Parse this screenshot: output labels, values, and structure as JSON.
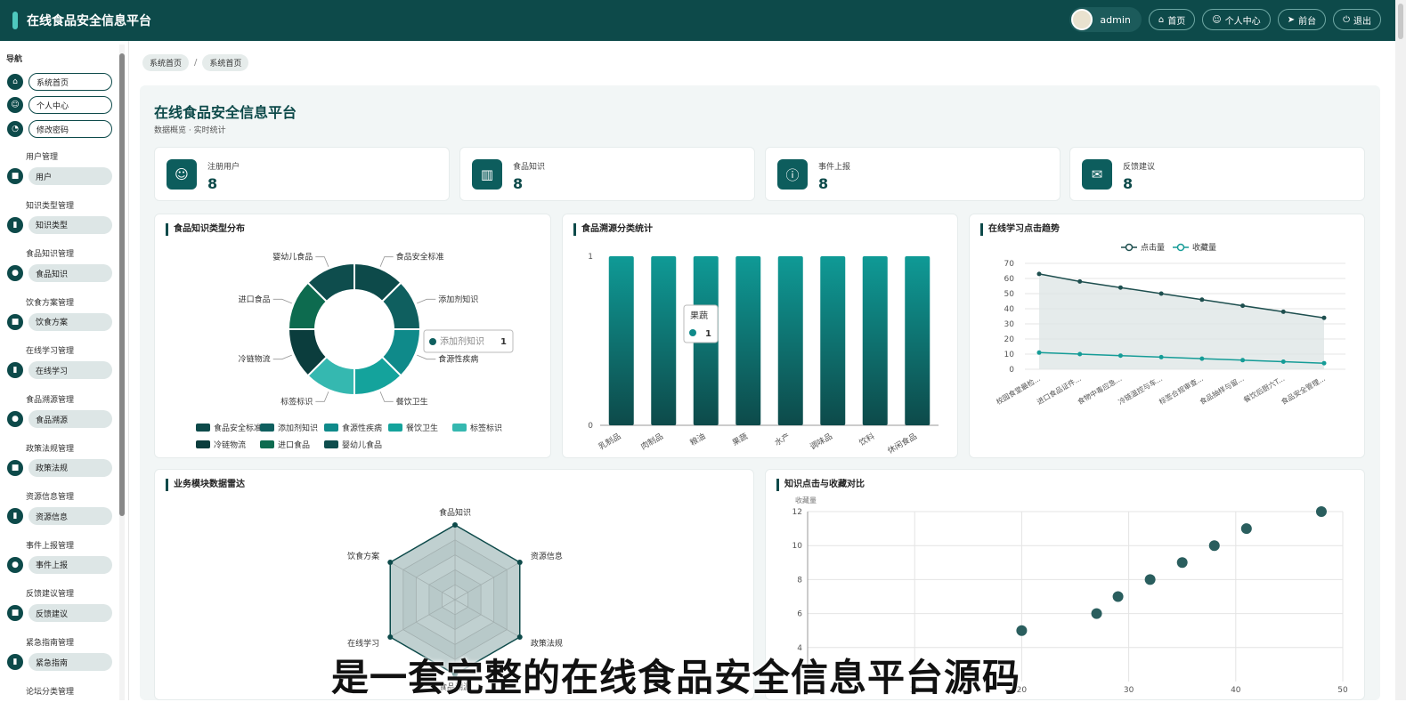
{
  "app": {
    "title": "在线食品安全信息平台"
  },
  "header": {
    "username": "admin",
    "buttons": [
      {
        "label": "首页",
        "icon": "home-icon"
      },
      {
        "label": "个人中心",
        "icon": "user-icon"
      },
      {
        "label": "前台",
        "icon": "send-icon"
      },
      {
        "label": "退出",
        "icon": "power-icon"
      }
    ]
  },
  "sidebar": {
    "title": "导航",
    "top_items": [
      {
        "label": "系统首页",
        "icon": "home-icon"
      },
      {
        "label": "个人中心",
        "icon": "user-icon"
      },
      {
        "label": "修改密码",
        "icon": "lock-icon"
      }
    ],
    "groups": [
      {
        "group": "用户管理",
        "item": "用户",
        "icon": "briefcase-icon"
      },
      {
        "group": "知识类型管理",
        "item": "知识类型",
        "icon": "bar-chart-icon"
      },
      {
        "group": "食品知识管理",
        "item": "食品知识",
        "icon": "location-icon"
      },
      {
        "group": "饮食方案管理",
        "item": "饮食方案",
        "icon": "briefcase-icon"
      },
      {
        "group": "在线学习管理",
        "item": "在线学习",
        "icon": "bar-chart-icon"
      },
      {
        "group": "食品溯源管理",
        "item": "食品溯源",
        "icon": "location-icon"
      },
      {
        "group": "政策法规管理",
        "item": "政策法规",
        "icon": "briefcase-icon"
      },
      {
        "group": "资源信息管理",
        "item": "资源信息",
        "icon": "bar-chart-icon"
      },
      {
        "group": "事件上报管理",
        "item": "事件上报",
        "icon": "location-icon"
      },
      {
        "group": "反馈建议管理",
        "item": "反馈建议",
        "icon": "briefcase-icon"
      },
      {
        "group": "紧急指南管理",
        "item": "紧急指南",
        "icon": "bar-chart-icon"
      },
      {
        "group": "论坛分类管理",
        "item": "",
        "icon": ""
      }
    ]
  },
  "breadcrumb": [
    "系统首页",
    "系统首页"
  ],
  "page": {
    "title": "在线食品安全信息平台",
    "subtitle": "数据概览 · 实时统计"
  },
  "stats": [
    {
      "label": "注册用户",
      "value": "8",
      "icon": "user-icon"
    },
    {
      "label": "食品知识",
      "value": "8",
      "icon": "book-icon"
    },
    {
      "label": "事件上报",
      "value": "8",
      "icon": "alert-icon"
    },
    {
      "label": "反馈建议",
      "value": "8",
      "icon": "chat-icon"
    }
  ],
  "cards": {
    "donut": "食品知识类型分布",
    "bar": "食品溯源分类统计",
    "line": "在线学习点击趋势",
    "radar": "业务模块数据雷达",
    "scatter": "知识点击与收藏对比"
  },
  "colors": {
    "primary": "#0d4a4a",
    "teal": "#0f8a8a",
    "light_teal": "#35b8b0",
    "green": "#0d6b4f"
  },
  "chart_data": [
    {
      "type": "pie",
      "title": "食品知识类型分布",
      "labels": [
        "食品安全标准",
        "添加剂知识",
        "食源性疾病",
        "餐饮卫生",
        "标签标识",
        "冷链物流",
        "进口食品",
        "婴幼儿食品"
      ],
      "values": [
        1,
        1,
        1,
        1,
        1,
        1,
        1,
        1
      ],
      "colors": [
        "#0d4a4a",
        "#0f5f5f",
        "#0f8a8a",
        "#14a39c",
        "#35b8b0",
        "#0b3d3d",
        "#0d6b4f",
        "#0e4d4d"
      ],
      "tooltip": {
        "label": "添加剂知识",
        "value": "1"
      },
      "legend": "bottom"
    },
    {
      "type": "bar",
      "title": "食品溯源分类统计",
      "categories": [
        "乳制品",
        "肉制品",
        "粮油",
        "果蔬",
        "水产",
        "调味品",
        "饮料",
        "休闲食品"
      ],
      "values": [
        1,
        1,
        1,
        1,
        1,
        1,
        1,
        1
      ],
      "ylim": [
        0,
        1
      ],
      "yticks": [
        "0",
        "1"
      ],
      "tooltip": {
        "label": "果蔬",
        "value": "1"
      }
    },
    {
      "type": "line",
      "title": "在线学习点击趋势",
      "categories": [
        "校园食堂最检...",
        "进口食品证件...",
        "食物中毒应急...",
        "冷链温控与车...",
        "标签合规审查...",
        "食品抽样与留...",
        "餐饮后厨六T...",
        "食品安全管理..."
      ],
      "series": [
        {
          "name": "点击量",
          "values": [
            63,
            58,
            54,
            50,
            46,
            42,
            38,
            34
          ]
        },
        {
          "name": "收藏量",
          "values": [
            11,
            10,
            9,
            8,
            7,
            6,
            5,
            4
          ]
        }
      ],
      "ylim": [
        0,
        70
      ],
      "yticks": [
        "0",
        "10",
        "20",
        "30",
        "40",
        "50",
        "60",
        "70"
      ],
      "legend": "top"
    },
    {
      "type": "radar",
      "title": "业务模块数据雷达",
      "indicators": [
        "食品知识",
        "资源信息",
        "政策法规",
        "食品溯源",
        "在线学习",
        "饮食方案"
      ],
      "values": [
        1,
        1,
        1,
        1,
        1,
        1
      ]
    },
    {
      "type": "scatter",
      "title": "知识点击与收藏对比",
      "ylabel": "收藏量",
      "points": [
        [
          20,
          5
        ],
        [
          27,
          6
        ],
        [
          29,
          7
        ],
        [
          32,
          8
        ],
        [
          35,
          9
        ],
        [
          38,
          10
        ],
        [
          41,
          11
        ],
        [
          48,
          12
        ]
      ],
      "xlim": [
        0,
        50
      ],
      "ylim": [
        2,
        12
      ],
      "xticks": [
        "10",
        "20",
        "30",
        "40",
        "50"
      ],
      "yticks": [
        "4",
        "6",
        "8",
        "10",
        "12"
      ]
    }
  ],
  "overlay": {
    "caption": "是一套完整的在线食品安全信息平台源码"
  }
}
